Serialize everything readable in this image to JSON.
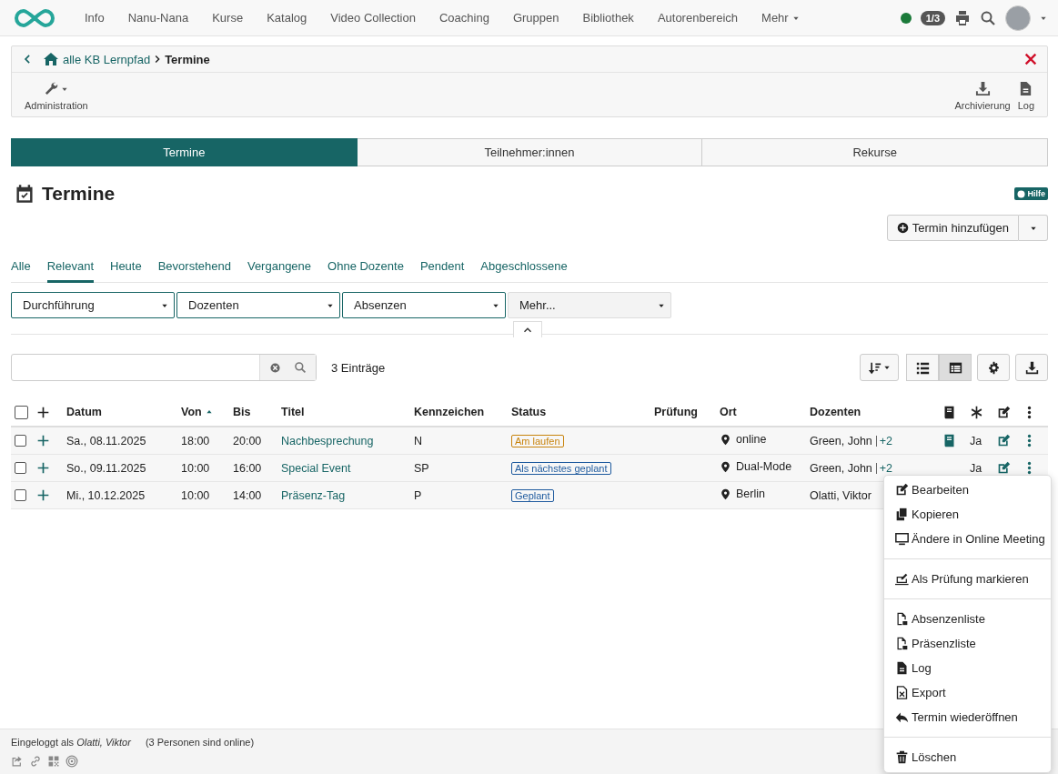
{
  "nav": {
    "items": [
      {
        "label": "Info"
      },
      {
        "label": "Nanu-Nana"
      },
      {
        "label": "Kurse"
      },
      {
        "label": "Katalog"
      },
      {
        "label": "Video Collection"
      },
      {
        "label": "Coaching"
      },
      {
        "label": "Gruppen"
      },
      {
        "label": "Bibliothek"
      },
      {
        "label": "Autorenbereich"
      },
      {
        "label": "Mehr",
        "dropdown": true
      }
    ],
    "online": true,
    "counter": "1/3"
  },
  "breadcrumb": {
    "items": [
      "alle KB Lernpfad"
    ],
    "current": "Termine"
  },
  "toolbar": {
    "left": [
      {
        "label": "Administration",
        "kind": "wrench"
      }
    ],
    "right": [
      {
        "label": "Archivierung",
        "kind": "download"
      },
      {
        "label": "Log",
        "kind": "file"
      }
    ]
  },
  "segments": [
    {
      "label": "Termine",
      "selected": true
    },
    {
      "label": "Teilnehmer:innen",
      "selected": false
    },
    {
      "label": "Rekurse",
      "selected": false
    }
  ],
  "heading": "Termine",
  "help": "Hilfe",
  "add_button": "Termin hinzufügen",
  "filter_tabs": [
    {
      "label": "Alle",
      "selected": false
    },
    {
      "label": "Relevant",
      "selected": true
    },
    {
      "label": "Heute",
      "selected": false
    },
    {
      "label": "Bevorstehend",
      "selected": false
    },
    {
      "label": "Vergangene",
      "selected": false
    },
    {
      "label": "Ohne Dozente",
      "selected": false
    },
    {
      "label": "Pendent",
      "selected": false
    },
    {
      "label": "Abgeschlossene",
      "selected": false
    }
  ],
  "filters": [
    {
      "label": "Durchführung",
      "active": true
    },
    {
      "label": "Dozenten",
      "active": true
    },
    {
      "label": "Absenzen",
      "active": true
    },
    {
      "label": "Mehr...",
      "active": false
    }
  ],
  "count": "3 Einträge",
  "views": [
    {
      "kind": "list",
      "selected": false
    },
    {
      "kind": "table",
      "selected": true
    }
  ],
  "table": {
    "all_checked": false,
    "columns": [
      {
        "label": "Datum",
        "sorted": false
      },
      {
        "label": "Von",
        "sorted": true
      },
      {
        "label": "Bis",
        "sorted": false
      },
      {
        "label": "Titel",
        "sorted": false
      },
      {
        "label": "Kennzeichen",
        "sorted": false
      },
      {
        "label": "Status",
        "sorted": false
      },
      {
        "label": "Prüfung",
        "sorted": false
      },
      {
        "label": "Ort",
        "sorted": false
      },
      {
        "label": "Dozenten",
        "sorted": false
      }
    ],
    "rows": [
      {
        "checked": false,
        "date": "Sa., 08.11.2025",
        "from": "18:00",
        "to": "20:00",
        "title": "Nachbesprechung",
        "code": "N",
        "status": {
          "label": "Am laufen",
          "color": "#c8830c"
        },
        "place": "online",
        "lecturers": "Green, John",
        "more_lecturers": "+2",
        "book": true,
        "flag": "Ja",
        "actions": true
      },
      {
        "checked": false,
        "date": "So., 09.11.2025",
        "from": "10:00",
        "to": "16:00",
        "title": "Special Event",
        "code": "SP",
        "status": {
          "label": "Als nächstes geplant",
          "color": "#1e5a9e"
        },
        "place": "Dual-Mode",
        "lecturers": "Green, John",
        "more_lecturers": "+2",
        "book": false,
        "flag": "Ja",
        "actions": true
      },
      {
        "checked": false,
        "date": "Mi., 10.12.2025",
        "from": "10:00",
        "to": "14:00",
        "title": "Präsenz-Tag",
        "code": "P",
        "status": {
          "label": "Geplant",
          "color": "#1e5a9e"
        },
        "place": "Berlin",
        "lecturers": "Olatti, Viktor"
      }
    ]
  },
  "menu": {
    "sections": [
      [
        {
          "label": "Bearbeiten",
          "kind": "edit"
        },
        {
          "label": "Kopieren",
          "kind": "copy"
        },
        {
          "label": "Ändere in Online Meeting",
          "kind": "screen"
        }
      ],
      [
        {
          "label": "Als Prüfung markieren",
          "kind": "exam"
        }
      ],
      [
        {
          "label": "Absenzenliste",
          "kind": "pdf"
        },
        {
          "label": "Präsenzliste",
          "kind": "pdf"
        },
        {
          "label": "Log",
          "kind": "file"
        },
        {
          "label": "Export",
          "kind": "excel"
        },
        {
          "label": "Termin wiederöffnen",
          "kind": "reply"
        }
      ],
      [
        {
          "label": "Löschen",
          "kind": "trash"
        }
      ]
    ]
  },
  "footer": {
    "login": "Eingeloggt als *Olatti, Viktor*",
    "online": "(3 Personen sind online)"
  }
}
